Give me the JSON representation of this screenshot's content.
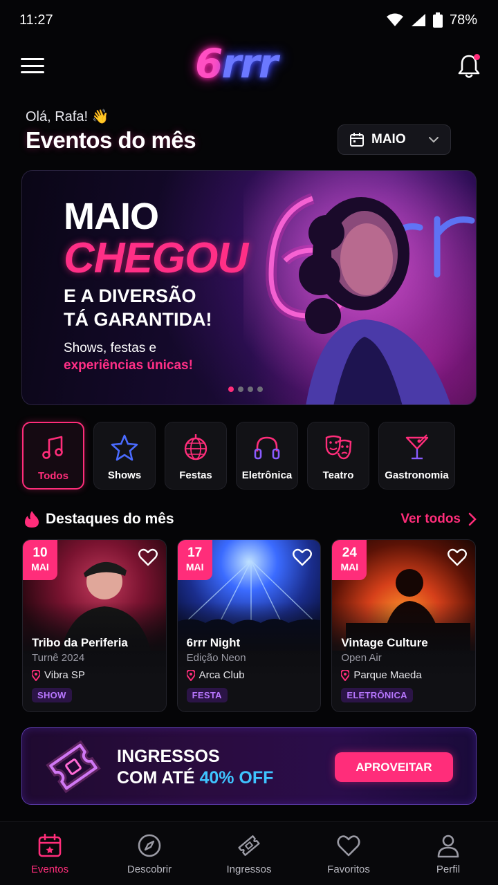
{
  "status_bar": {
    "time": "11:27",
    "battery": "78%"
  },
  "header": {
    "logo_six": "6",
    "logo_rrr": "rrr"
  },
  "greeting": {
    "hello": "Olá, Rafa! 👋",
    "title": "Eventos do mês"
  },
  "month_select": {
    "value": "MAIO"
  },
  "banner": {
    "line1": "MAIO",
    "line2": "CHEGOU",
    "line3a": "E A DIVERSÃO",
    "line3b": "TÁ GARANTIDA!",
    "sub1": "Shows, festas e",
    "sub2": "experiências únicas!",
    "slides": 4,
    "active_slide": 1
  },
  "categories": [
    {
      "label": "Todos",
      "icon": "music-note-icon",
      "active": true
    },
    {
      "label": "Shows",
      "icon": "star-icon",
      "active": false
    },
    {
      "label": "Festas",
      "icon": "disco-ball-icon",
      "active": false
    },
    {
      "label": "Eletrônica",
      "icon": "headphones-icon",
      "active": false
    },
    {
      "label": "Teatro",
      "icon": "theater-masks-icon",
      "active": false
    },
    {
      "label": "Gastronomia",
      "icon": "cocktail-icon",
      "active": false
    }
  ],
  "highlights": {
    "title": "Destaques do mês",
    "see_all": "Ver todos",
    "events": [
      {
        "day": "10",
        "month": "MAI",
        "title": "Tribo da Periferia",
        "subtitle": "Turnê 2024",
        "venue": "Vibra SP",
        "tag": "SHOW"
      },
      {
        "day": "17",
        "month": "MAI",
        "title": "6rrr Night",
        "subtitle": "Edição Neon",
        "venue": "Arca Club",
        "tag": "FESTA"
      },
      {
        "day": "24",
        "month": "MAI",
        "title": "Vintage Culture",
        "subtitle": "Open Air",
        "venue": "Parque Maeda",
        "tag": "ELETRÔNICA"
      }
    ]
  },
  "promo": {
    "line1": "INGRESSOS",
    "line2_pre": "COM ATÉ ",
    "line2_accent": "40% OFF",
    "button": "APROVEITAR"
  },
  "bottom_nav": [
    {
      "label": "Eventos",
      "icon": "calendar-icon",
      "active": true
    },
    {
      "label": "Descobrir",
      "icon": "compass-icon",
      "active": false
    },
    {
      "label": "Ingressos",
      "icon": "ticket-icon",
      "active": false
    },
    {
      "label": "Favoritos",
      "icon": "heart-icon",
      "active": false
    },
    {
      "label": "Perfil",
      "icon": "user-icon",
      "active": false
    }
  ],
  "colors": {
    "accent": "#ff2d7a",
    "accent_blue": "#3fc4ff",
    "tag_purple": "#b877ff",
    "background": "#050507"
  }
}
